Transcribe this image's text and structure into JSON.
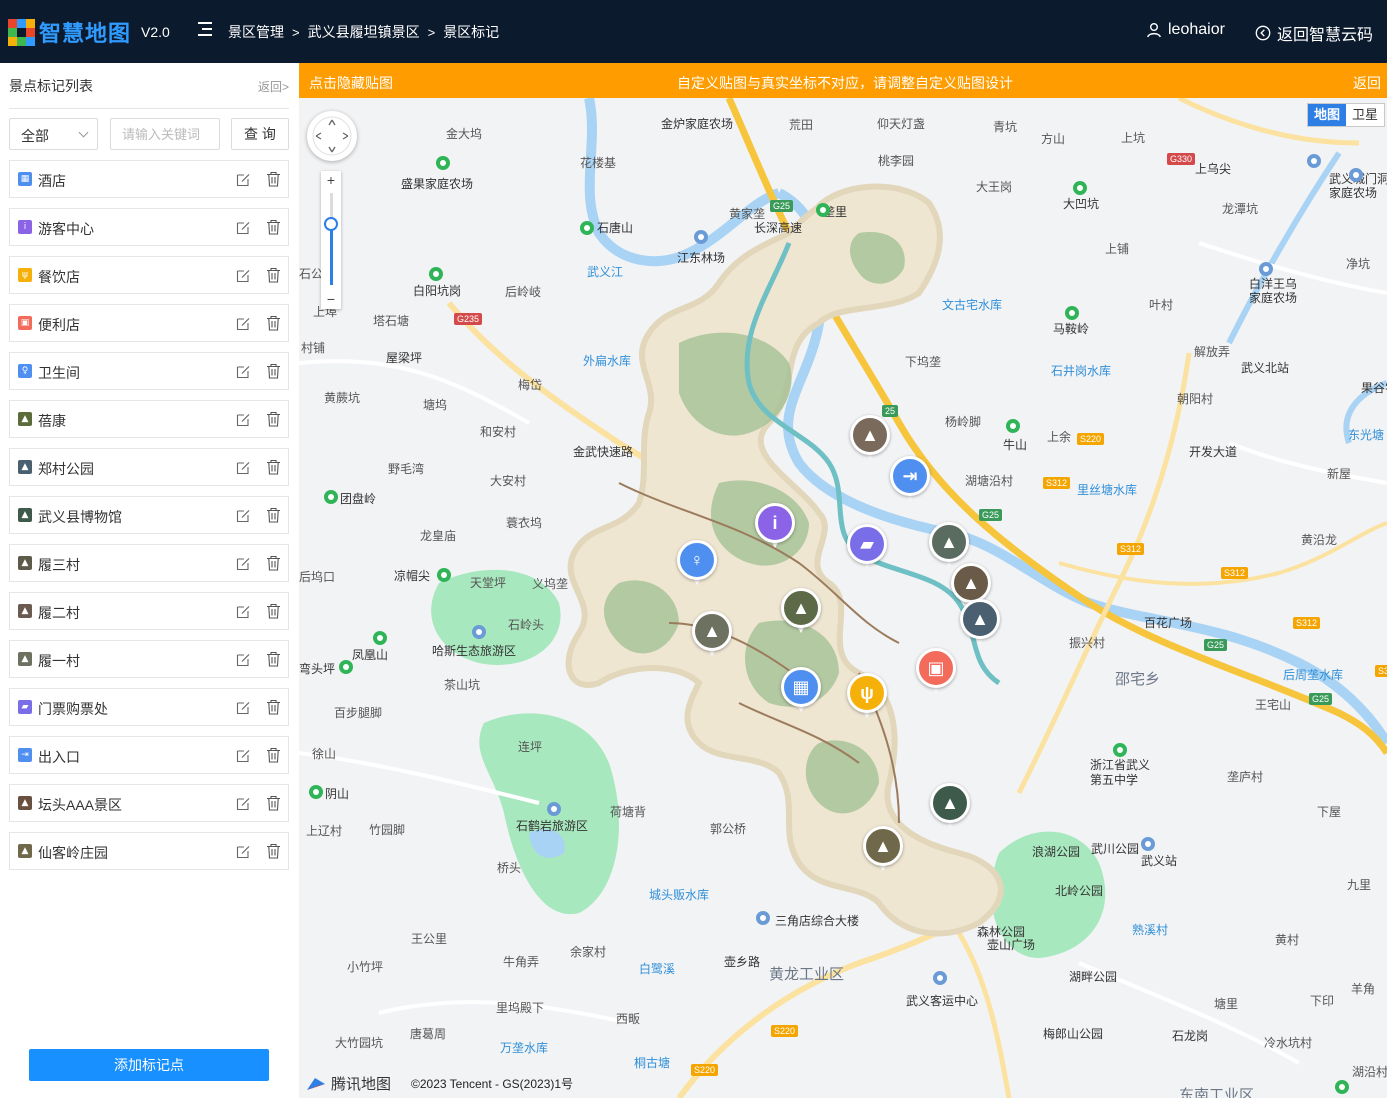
{
  "header": {
    "logo_text": "智慧地图",
    "version": "V2.0",
    "breadcrumb": [
      "景区管理",
      "武义县履坦镇景区",
      "景区标记"
    ],
    "separator": ">",
    "username": "leohaior",
    "back_cloud": "返回智慧云码",
    "user_icon": "user-icon",
    "back_icon": "circle-arrow-left-icon"
  },
  "sidebar": {
    "title": "景点标记列表",
    "back": "返回>",
    "filter_value": "全部",
    "search_placeholder": "请输入关键词",
    "query_button": "查 询",
    "add_button": "添加标记点",
    "items": [
      {
        "label": "酒店",
        "icon": "hotel-icon",
        "color": "#4f8ff0"
      },
      {
        "label": "游客中心",
        "icon": "info-icon",
        "color": "#8a63e6"
      },
      {
        "label": "餐饮店",
        "icon": "restaurant-icon",
        "color": "#f5b10a"
      },
      {
        "label": "便利店",
        "icon": "store-icon",
        "color": "#f26b5b"
      },
      {
        "label": "卫生间",
        "icon": "toilet-icon",
        "color": "#4f8ff0"
      },
      {
        "label": "蓓康",
        "icon": "photo-thumbnail-icon",
        "color": "#5b6b3a"
      },
      {
        "label": "郑村公园",
        "icon": "photo-thumbnail-icon",
        "color": "#4a6070"
      },
      {
        "label": "武义县博物馆",
        "icon": "photo-thumbnail-icon",
        "color": "#3e5a4a"
      },
      {
        "label": "履三村",
        "icon": "photo-thumbnail-icon",
        "color": "#5c5a48"
      },
      {
        "label": "履二村",
        "icon": "photo-thumbnail-icon",
        "color": "#6a5a50"
      },
      {
        "label": "履一村",
        "icon": "photo-thumbnail-icon",
        "color": "#6d7260"
      },
      {
        "label": "门票购票处",
        "icon": "ticket-icon",
        "color": "#7a6ee8"
      },
      {
        "label": "出入口",
        "icon": "exit-icon",
        "color": "#4f8ff0"
      },
      {
        "label": "坛头AAA景区",
        "icon": "photo-thumbnail-icon",
        "color": "#6a5040"
      },
      {
        "label": "仙客岭庄园",
        "icon": "photo-thumbnail-icon",
        "color": "#70684a"
      }
    ]
  },
  "map": {
    "notice_left": "点击隐藏贴图",
    "notice_message": "自定义贴图与真实坐标不对应，请调整自定义贴图设计",
    "notice_right": "返回",
    "maptype": [
      "地图",
      "卫星"
    ],
    "maptype_selected": "地图",
    "zoom_in": "+",
    "zoom_out": "−",
    "provider": "腾讯地图",
    "copyright": "©2023 Tencent - GS(2023)1号",
    "colors": {
      "notice": "#ff9d00",
      "water": "#a9d3f4",
      "park": "#a8e8be",
      "highway": "#f6c53c",
      "primary": "#1890ff"
    },
    "places": [
      {
        "t": "金炉家庭农场",
        "c": "dark"
      },
      {
        "t": "金大坞",
        "c": ""
      },
      {
        "t": "荒田",
        "c": ""
      },
      {
        "t": "仰天灯盏",
        "c": ""
      },
      {
        "t": "青坑",
        "c": ""
      },
      {
        "t": "方山",
        "c": ""
      },
      {
        "t": "上坑",
        "c": ""
      },
      {
        "t": "上乌尖",
        "c": "dark"
      },
      {
        "t": "武义城门洞",
        "c": "dark"
      },
      {
        "t": "家庭农场",
        "c": "dark"
      },
      {
        "t": "花楼基",
        "c": ""
      },
      {
        "t": "桃李园",
        "c": ""
      },
      {
        "t": "盛果家庭农场",
        "c": "dark"
      },
      {
        "t": "大王岗",
        "c": ""
      },
      {
        "t": "大凹坑",
        "c": "dark"
      },
      {
        "t": "龙潭坑",
        "c": ""
      },
      {
        "t": "黄家垄",
        "c": ""
      },
      {
        "t": "垄里",
        "c": "dark"
      },
      {
        "t": "石唐山",
        "c": "dark"
      },
      {
        "t": "江东林场",
        "c": "dark"
      },
      {
        "t": "上铺",
        "c": ""
      },
      {
        "t": "净坑",
        "c": ""
      },
      {
        "t": "白洋王乌",
        "c": "dark"
      },
      {
        "t": "家庭农场",
        "c": "dark"
      },
      {
        "t": "武义江",
        "c": "blue"
      },
      {
        "t": "石公",
        "c": ""
      },
      {
        "t": "白阳坑岗",
        "c": "dark"
      },
      {
        "t": "后岭岐",
        "c": ""
      },
      {
        "t": "叶村",
        "c": ""
      },
      {
        "t": "文古宅水库",
        "c": "blue"
      },
      {
        "t": "马鞍岭",
        "c": "dark"
      },
      {
        "t": "上埠",
        "c": ""
      },
      {
        "t": "塔石塘",
        "c": ""
      },
      {
        "t": "村铺",
        "c": ""
      },
      {
        "t": "屋梁坪",
        "c": "dark"
      },
      {
        "t": "外扁水库",
        "c": "blue"
      },
      {
        "t": "下坞垄",
        "c": ""
      },
      {
        "t": "解放弄",
        "c": ""
      },
      {
        "t": "武义北站",
        "c": "dark"
      },
      {
        "t": "石井岗水库",
        "c": "blue"
      },
      {
        "t": "果谷农场",
        "c": "dark"
      },
      {
        "t": "黄蕨坑",
        "c": ""
      },
      {
        "t": "塘坞",
        "c": ""
      },
      {
        "t": "梅岱",
        "c": ""
      },
      {
        "t": "朝阳村",
        "c": ""
      },
      {
        "t": "杨岭脚",
        "c": ""
      },
      {
        "t": "东光塘",
        "c": "blue"
      },
      {
        "t": "和安村",
        "c": ""
      },
      {
        "t": "牛山",
        "c": "dark"
      },
      {
        "t": "上余",
        "c": ""
      },
      {
        "t": "野毛湾",
        "c": ""
      },
      {
        "t": "大安村",
        "c": ""
      },
      {
        "t": "湖塘沿村",
        "c": ""
      },
      {
        "t": "里丝塘水库",
        "c": "blue"
      },
      {
        "t": "新屋",
        "c": ""
      },
      {
        "t": "团盘岭",
        "c": "dark"
      },
      {
        "t": "蓑衣坞",
        "c": ""
      },
      {
        "t": "龙皇庙",
        "c": ""
      },
      {
        "t": "黄沿龙",
        "c": ""
      },
      {
        "t": "后坞口",
        "c": ""
      },
      {
        "t": "凉帽尖",
        "c": "dark"
      },
      {
        "t": "天堂坪",
        "c": ""
      },
      {
        "t": "义坞垄",
        "c": ""
      },
      {
        "t": "百花广场",
        "c": "dark"
      },
      {
        "t": "石岭头",
        "c": ""
      },
      {
        "t": "振兴村",
        "c": ""
      },
      {
        "t": "凤凰山",
        "c": "dark"
      },
      {
        "t": "哈斯生态旅游区",
        "c": "dark"
      },
      {
        "t": "后周垄水库",
        "c": "blue"
      },
      {
        "t": "弯头坪",
        "c": "dark"
      },
      {
        "t": "茶山坑",
        "c": ""
      },
      {
        "t": "邵宅乡",
        "c": "big"
      },
      {
        "t": "百步腿脚",
        "c": ""
      },
      {
        "t": "王宅山",
        "c": ""
      },
      {
        "t": "徐山",
        "c": ""
      },
      {
        "t": "连坪",
        "c": ""
      },
      {
        "t": "浙江省武义",
        "c": "dark"
      },
      {
        "t": "第五中学",
        "c": "dark"
      },
      {
        "t": "垄庐村",
        "c": ""
      },
      {
        "t": "阴山",
        "c": "dark"
      },
      {
        "t": "荷塘背",
        "c": ""
      },
      {
        "t": "上辽村",
        "c": ""
      },
      {
        "t": "竹园脚",
        "c": ""
      },
      {
        "t": "石鹤岩旅游区",
        "c": "dark"
      },
      {
        "t": "郭公桥",
        "c": ""
      },
      {
        "t": "下屋",
        "c": ""
      },
      {
        "t": "浪湖公园",
        "c": "dark"
      },
      {
        "t": "武川公园",
        "c": "dark"
      },
      {
        "t": "武义站",
        "c": "dark"
      },
      {
        "t": "桥头",
        "c": ""
      },
      {
        "t": "九里",
        "c": ""
      },
      {
        "t": "城头贩水库",
        "c": "blue"
      },
      {
        "t": "北岭公园",
        "c": "dark"
      },
      {
        "t": "三角店综合大楼",
        "c": "dark"
      },
      {
        "t": "森林公园",
        "c": "dark"
      },
      {
        "t": "熟溪村",
        "c": "blue"
      },
      {
        "t": "王公里",
        "c": ""
      },
      {
        "t": "壶山广场",
        "c": "dark"
      },
      {
        "t": "黄村",
        "c": ""
      },
      {
        "t": "小竹坪",
        "c": ""
      },
      {
        "t": "牛角弄",
        "c": ""
      },
      {
        "t": "余家村",
        "c": ""
      },
      {
        "t": "白鹭溪",
        "c": "blue"
      },
      {
        "t": "黄龙工业区",
        "c": "big"
      },
      {
        "t": "湖畔公园",
        "c": "dark"
      },
      {
        "t": "武义客运中心",
        "c": "dark"
      },
      {
        "t": "羊角",
        "c": ""
      },
      {
        "t": "里坞殿下",
        "c": ""
      },
      {
        "t": "塘里",
        "c": ""
      },
      {
        "t": "下印",
        "c": ""
      },
      {
        "t": "西畈",
        "c": ""
      },
      {
        "t": "大竹园坑",
        "c": ""
      },
      {
        "t": "唐葛周",
        "c": ""
      },
      {
        "t": "万垄水库",
        "c": "blue"
      },
      {
        "t": "梅郎山公园",
        "c": "dark"
      },
      {
        "t": "石龙岗",
        "c": "dark"
      },
      {
        "t": "冷水坑村",
        "c": ""
      },
      {
        "t": "桐古塘",
        "c": "blue"
      },
      {
        "t": "湖沿村",
        "c": ""
      },
      {
        "t": "东南工业区",
        "c": "big"
      },
      {
        "t": "金武快速路",
        "c": "dark"
      },
      {
        "t": "长深高速",
        "c": "dark"
      },
      {
        "t": "开发大道",
        "c": "dark"
      },
      {
        "t": "壶乡路",
        "c": "dark"
      }
    ]
  }
}
